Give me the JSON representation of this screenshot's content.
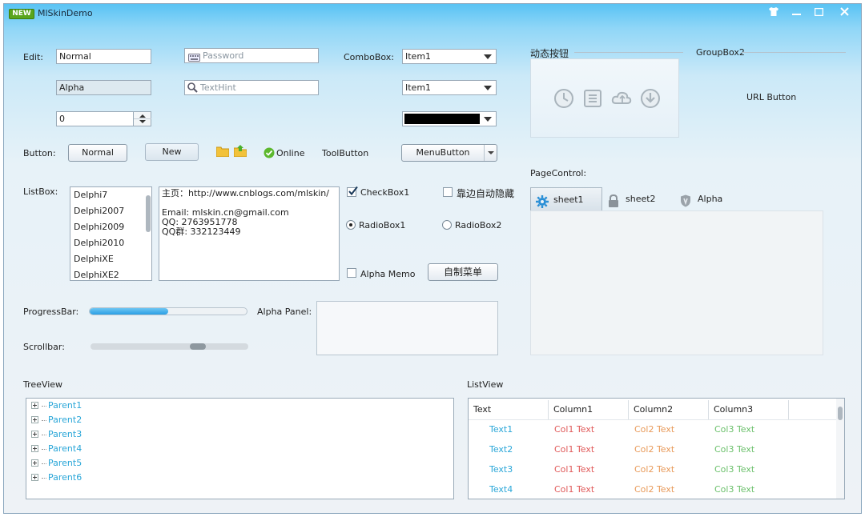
{
  "titlebar": {
    "badge": "NEW",
    "title": "MlSkinDemo"
  },
  "edit": {
    "label": "Edit:",
    "normal_value": "Normal",
    "password_placeholder": "Password",
    "alpha_value": "Alpha",
    "hint_placeholder": "TextHint",
    "spin_value": "0"
  },
  "combo": {
    "label": "ComboBox:",
    "item1": "Item1",
    "item2": "Item1"
  },
  "buttons": {
    "label": "Button:",
    "normal": "Normal",
    "new": "New",
    "online": "Online",
    "toolbutton": "ToolButton",
    "menubutton": "MenuButton"
  },
  "listbox": {
    "label": "ListBox:",
    "items": [
      "Delphi7",
      "Delphi2007",
      "Delphi2009",
      "Delphi2010",
      "DelphiXE",
      "DelphiXE2"
    ]
  },
  "memo": {
    "lines": [
      "主页：http://www.cnblogs.com/mlskin/",
      "",
      "Email: mlskin.cn@gmail.com",
      "QQ: 2763951778",
      "QQ群: 332123449"
    ]
  },
  "checks": {
    "checkbox1": "CheckBox1",
    "autohide": "靠边自动隐藏",
    "radio1": "RadioBox1",
    "radio2": "RadioBox2",
    "alphamemo": "Alpha Memo",
    "custommenu": "自制菜单"
  },
  "progress": {
    "label": "ProgressBar:",
    "value_percent": 50
  },
  "scroll": {
    "label": "Scrollbar:",
    "position_fraction": 0.7
  },
  "alpha_panel": {
    "label": "Alpha Panel:"
  },
  "groupbox1": {
    "title": "动态按钮"
  },
  "groupbox2": {
    "title": "GroupBox2",
    "url_button": "URL Button"
  },
  "pagecontrol": {
    "label": "PageControl:",
    "tabs": [
      "sheet1",
      "sheet2",
      "Alpha"
    ]
  },
  "treeview": {
    "label": "TreeView",
    "nodes": [
      "Parent1",
      "Parent2",
      "Parent3",
      "Parent4",
      "Parent5",
      "Parent6"
    ]
  },
  "listview": {
    "label": "ListView",
    "columns": [
      "Text",
      "Column1",
      "Column2",
      "Column3"
    ],
    "rows": [
      [
        "Text1",
        "Col1 Text",
        "Col2 Text",
        "Col3 Text"
      ],
      [
        "Text2",
        "Col1 Text",
        "Col2 Text",
        "Col3 Text"
      ],
      [
        "Text3",
        "Col1 Text",
        "Col2 Text",
        "Col3 Text"
      ],
      [
        "Text4",
        "Col1 Text",
        "Col2 Text",
        "Col3 Text"
      ]
    ],
    "colors": [
      "#29a6d8",
      "#e05a5a",
      "#e89a5a",
      "#6cc06c"
    ]
  }
}
